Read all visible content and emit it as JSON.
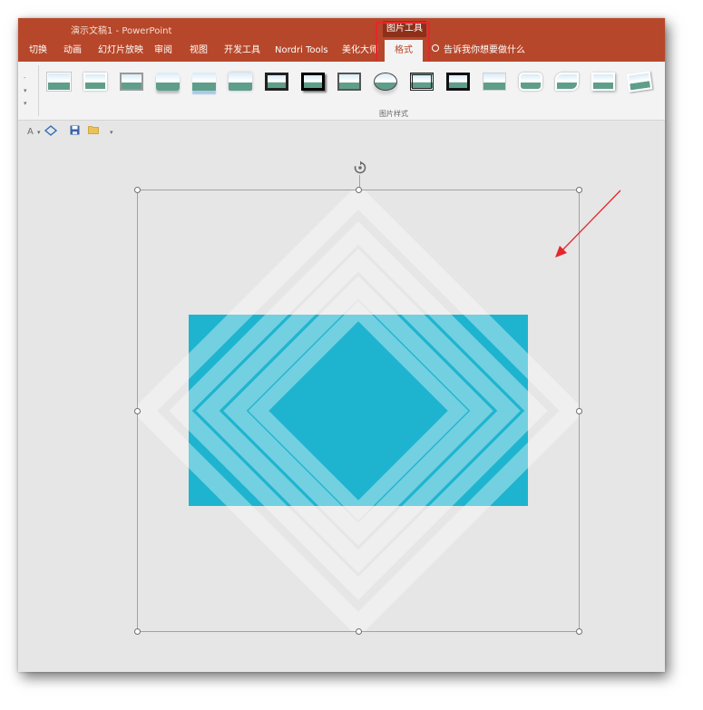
{
  "window": {
    "title": "演示文稿1  -  PowerPoint",
    "context_tab_group": "图片工具"
  },
  "tabs": [
    {
      "label": "切换",
      "active": false
    },
    {
      "label": "动画",
      "active": false
    },
    {
      "label": "幻灯片放映",
      "active": false
    },
    {
      "label": "审阅",
      "active": false
    },
    {
      "label": "视图",
      "active": false
    },
    {
      "label": "开发工具",
      "active": false
    },
    {
      "label": "Nordri Tools",
      "active": false
    },
    {
      "label": "美化大师",
      "active": false
    },
    {
      "label": "格式",
      "active": true
    }
  ],
  "tell_me": {
    "label": "告诉我你想要做什么",
    "icon": "lightbulb-icon"
  },
  "ribbon": {
    "group_label": "图片样式",
    "gallery_styles": [
      "simple-frame-white",
      "soft-edge",
      "shadow-rectangle",
      "reflected-rounded",
      "reflected-bevel",
      "soft-edge-oval",
      "thick-black-frame",
      "black-frame-shadow",
      "metal-frame",
      "oval",
      "double-frame-black",
      "thick-matte-black",
      "simple-frame-black",
      "rounded-diagonal",
      "snip-diagonal",
      "moderate-frame",
      "rotated-white"
    ]
  },
  "quick_access": {
    "items": [
      "A",
      "▾",
      "save-icon",
      "folder-icon",
      "▾"
    ]
  },
  "colors": {
    "title_bar": "#b7472a",
    "context_tab": "#8e3019",
    "highlight": "#e5262d",
    "picture_fill": "#1eb4cf",
    "canvas": "#e6e6e6"
  }
}
